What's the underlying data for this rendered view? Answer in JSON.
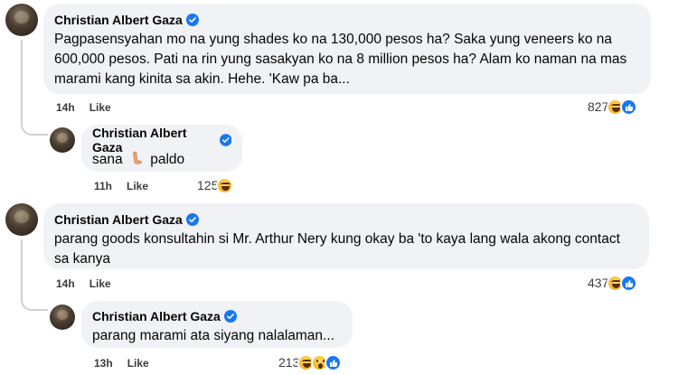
{
  "comments": [
    {
      "author": "Christian Albert Gaza",
      "text": "Pagpasensyahan mo na yung shades ko na 130,000 pesos ha? Saka yung veneers ko na 600,000 pesos. Pati na rin yung sasakyan ko na 8 million pesos ha? Alam ko naman na mas marami kang kinita sa akin. Hehe. 'Kaw pa ba...",
      "time": "14h",
      "like_label": "Like",
      "reaction_count": "827",
      "reactions": [
        "haha-icon",
        "like-icon"
      ],
      "reply": {
        "author": "Christian Albert Gaza",
        "text_before_emoji": "sana",
        "emoji": "leg-emoji",
        "text_after_emoji": "paldo",
        "time": "11h",
        "like_label": "Like",
        "reaction_count": "125",
        "reactions": [
          "haha-icon"
        ]
      }
    },
    {
      "author": "Christian Albert Gaza",
      "text": "parang goods konsultahin si Mr. Arthur Nery kung okay ba 'to kaya lang wala akong contact sa kanya",
      "time": "14h",
      "like_label": "Like",
      "reaction_count": "437",
      "reactions": [
        "haha-icon",
        "like-icon"
      ],
      "reply": {
        "author": "Christian Albert Gaza",
        "text": "parang marami ata siyang nalalaman...",
        "time": "13h",
        "like_label": "Like",
        "reaction_count": "213",
        "reactions": [
          "haha-icon",
          "wow-icon",
          "like-icon"
        ]
      }
    }
  ],
  "colors": {
    "bubble": "#f0f2f5",
    "verified": "#1877f2",
    "text": "#050505",
    "meta": "#3a3b3c"
  }
}
